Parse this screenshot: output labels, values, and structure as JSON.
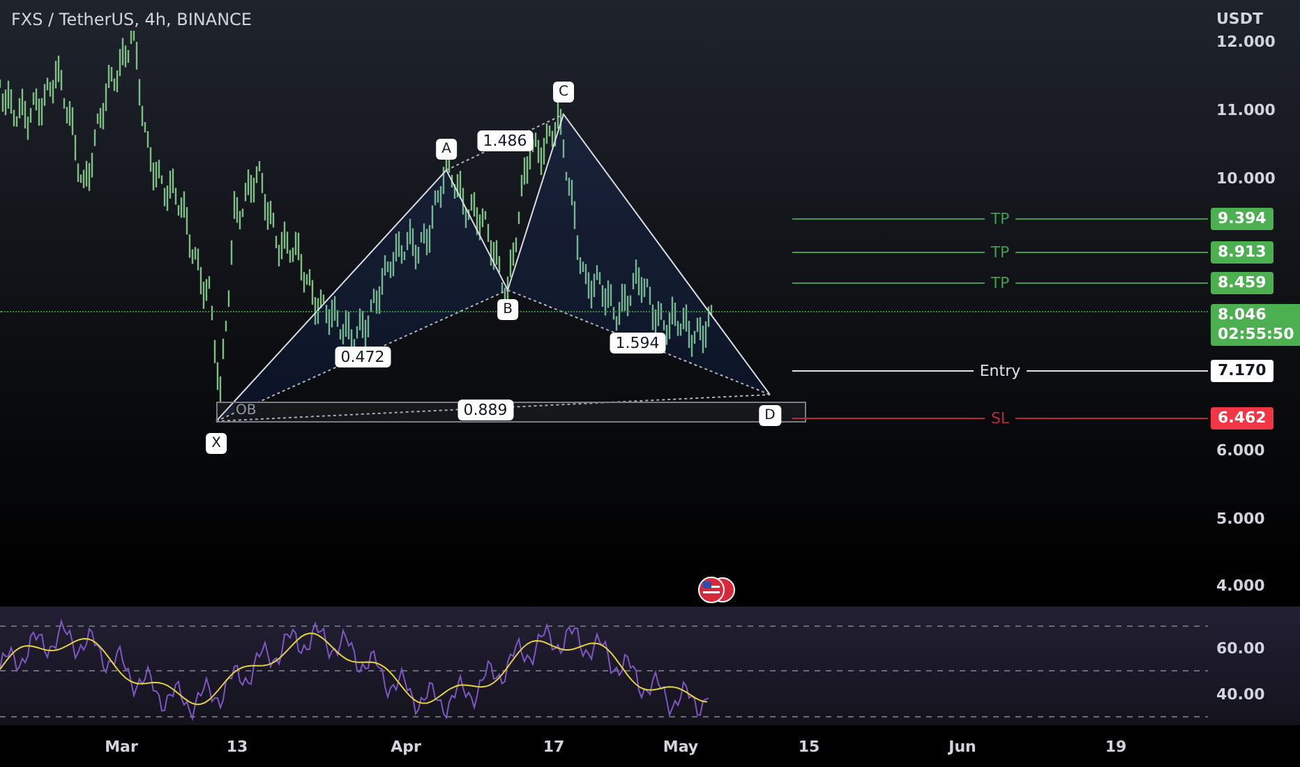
{
  "chart": {
    "title": "FXS / TetherUS, 4h, BINANCE",
    "currency": "USDT",
    "price_ticks": [
      "12.000",
      "11.000",
      "10.000",
      "6.000",
      "5.000",
      "4.000"
    ],
    "pattern": {
      "points": [
        {
          "label": "X"
        },
        {
          "label": "A"
        },
        {
          "label": "B"
        },
        {
          "label": "C"
        },
        {
          "label": "D"
        }
      ],
      "ratios": [
        "0.472",
        "1.486",
        "1.594",
        "0.889"
      ],
      "zone_label": "OB"
    },
    "levels": [
      {
        "kind": "tp",
        "label": "TP",
        "price": "9.394"
      },
      {
        "kind": "tp",
        "label": "TP",
        "price": "8.913"
      },
      {
        "kind": "tp",
        "label": "TP",
        "price": "8.459"
      },
      {
        "kind": "entry",
        "label": "Entry",
        "price": "7.170"
      },
      {
        "kind": "sl",
        "label": "SL",
        "price": "6.462"
      }
    ],
    "last_price": {
      "price": "8.046",
      "countdown": "02:55:50"
    }
  },
  "rsi": {
    "ticks": [
      "60.00",
      "40.00"
    ]
  },
  "time_axis": [
    "Mar",
    "13",
    "Apr",
    "17",
    "May",
    "15",
    "Jun",
    "19"
  ]
}
